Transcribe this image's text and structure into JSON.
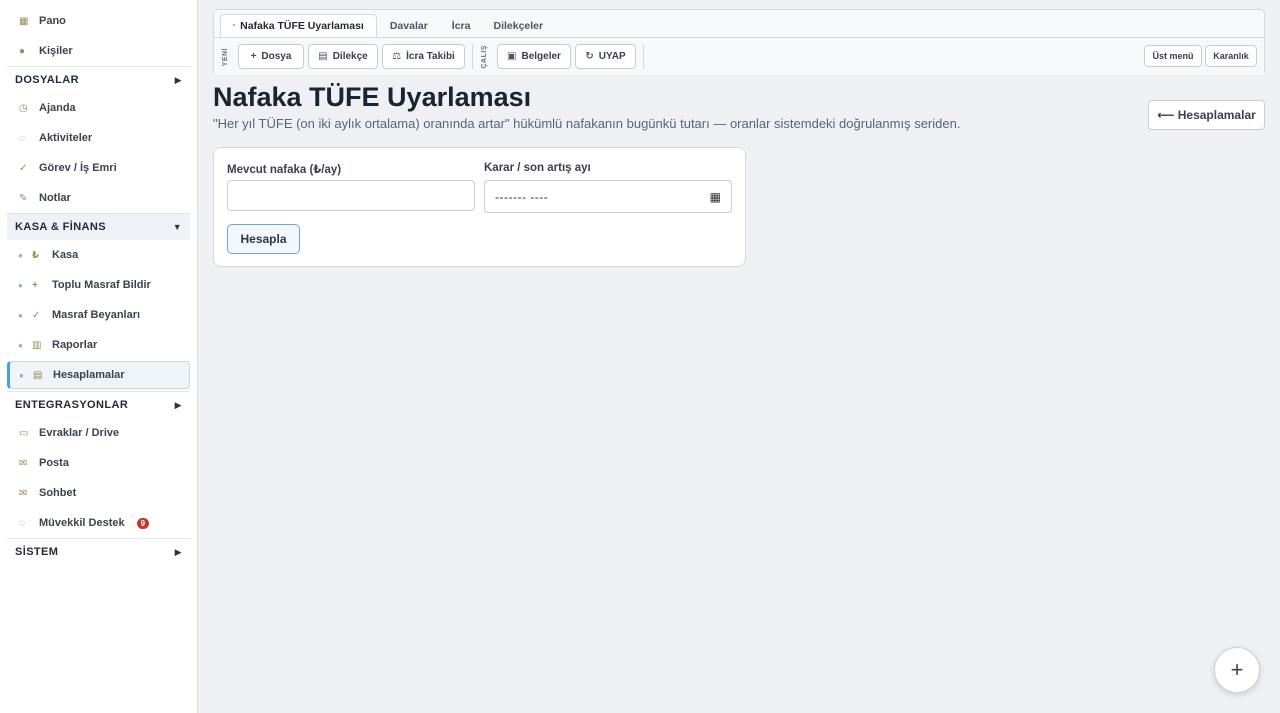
{
  "sidebar": {
    "top_items": [
      {
        "label": "Pano",
        "icon": "dashboard-icon",
        "glyph": "▦"
      },
      {
        "label": "Kişiler",
        "icon": "people-icon",
        "glyph": "●"
      }
    ],
    "sections": [
      {
        "label": "DOSYALAR",
        "arrow": "▶"
      },
      {
        "label": "KASA & FİNANS",
        "arrow": "▼"
      },
      {
        "label": "ENTEGRASYONLAR",
        "arrow": "▶"
      },
      {
        "label": "SİSTEM",
        "arrow": "▶"
      }
    ],
    "dosyalar_items": [
      {
        "label": "Ajanda",
        "glyph": "◷"
      },
      {
        "label": "Aktiviteler",
        "glyph": "◌"
      },
      {
        "label": "Görev / İş Emri",
        "glyph": "✓"
      },
      {
        "label": "Notlar",
        "glyph": "✎"
      }
    ],
    "finans_items": [
      {
        "label": "Kasa",
        "glyph": "₺"
      },
      {
        "label": "Toplu Masraf Bildir",
        "glyph": "+"
      },
      {
        "label": "Masraf Beyanları",
        "glyph": "✓"
      },
      {
        "label": "Raporlar",
        "glyph": "▥"
      },
      {
        "label": "Hesaplamalar",
        "glyph": "▤"
      }
    ],
    "entegrasyon_items": [
      {
        "label": "Evraklar / Drive",
        "glyph": "▭"
      },
      {
        "label": "Posta",
        "glyph": "✉"
      },
      {
        "label": "Sohbet",
        "glyph": "✉"
      },
      {
        "label": "Müvekkil Destek",
        "glyph": "◌",
        "badge": "9"
      }
    ]
  },
  "tabs": [
    {
      "label": "Nafaka TÜFE Uyarlaması",
      "pin": "•"
    },
    {
      "label": "Davalar"
    },
    {
      "label": "İcra"
    },
    {
      "label": "Dilekçeler"
    }
  ],
  "toolbar": {
    "yeni_label": "YENİ",
    "calis_label": "ÇALIŞ",
    "dosya": {
      "glyph": "+",
      "label": "Dosya"
    },
    "dilekce": {
      "glyph": "▤",
      "label": "Dilekçe"
    },
    "icra_takibi": {
      "glyph": "⚖",
      "label": "İcra Takibi"
    },
    "belgeler": {
      "glyph": "▣",
      "label": "Belgeler"
    },
    "uyap": {
      "glyph": "↻",
      "label": "UYAP"
    },
    "ust_menu": "Üst menü",
    "karanlik": "Karanlık"
  },
  "page": {
    "title": "Nafaka TÜFE Uyarlaması",
    "subtitle": "\"Her yıl TÜFE (on iki aylık ortalama) oranında artar\" hükümlü nafakanın bugünkü tutarı — oranlar sistemdeki doğrulanmış seriden.",
    "back_button": "⟵ Hesaplamalar"
  },
  "form": {
    "nafaka_label": "Mevcut nafaka (₺/ay)",
    "nafaka_value": "",
    "karar_label": "Karar / son artış ayı",
    "karar_value": "------- ----",
    "calendar_glyph": "▦",
    "submit": "Hesapla"
  },
  "fab": {
    "glyph": "+"
  }
}
